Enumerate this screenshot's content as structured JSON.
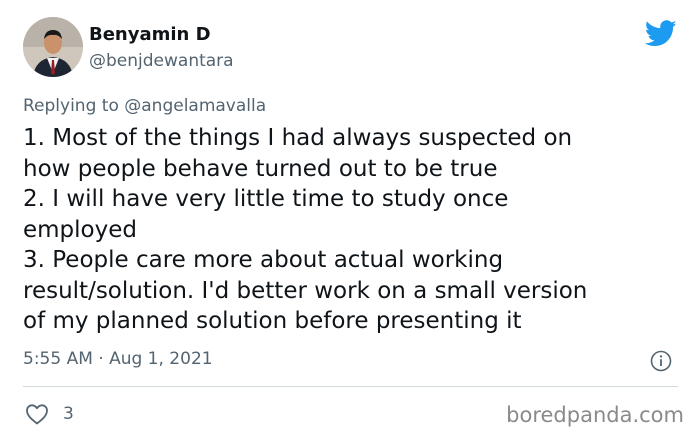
{
  "author": {
    "name": "Benyamin D",
    "handle": "@benjdewantara",
    "avatar_icon": "profile-photo"
  },
  "brand": {
    "icon": "twitter-bird-icon",
    "color": "#1d9bf0"
  },
  "reply": {
    "prefix": "Replying to",
    "handle": "@angelamavalla"
  },
  "tweet": {
    "lines": [
      "1. Most of the things I had always suspected on",
      "how people behave turned out to be true",
      "2. I will have very little time to study once",
      "employed",
      "3. People care more about actual working",
      "result/solution. I'd better work on a small version",
      "of my planned solution before presenting it"
    ]
  },
  "meta": {
    "timestamp": "5:55 AM · Aug 1, 2021",
    "info_icon": "info-icon"
  },
  "actions": {
    "like_icon": "heart-icon",
    "like_count": "3"
  },
  "watermark": "boredpanda.com"
}
